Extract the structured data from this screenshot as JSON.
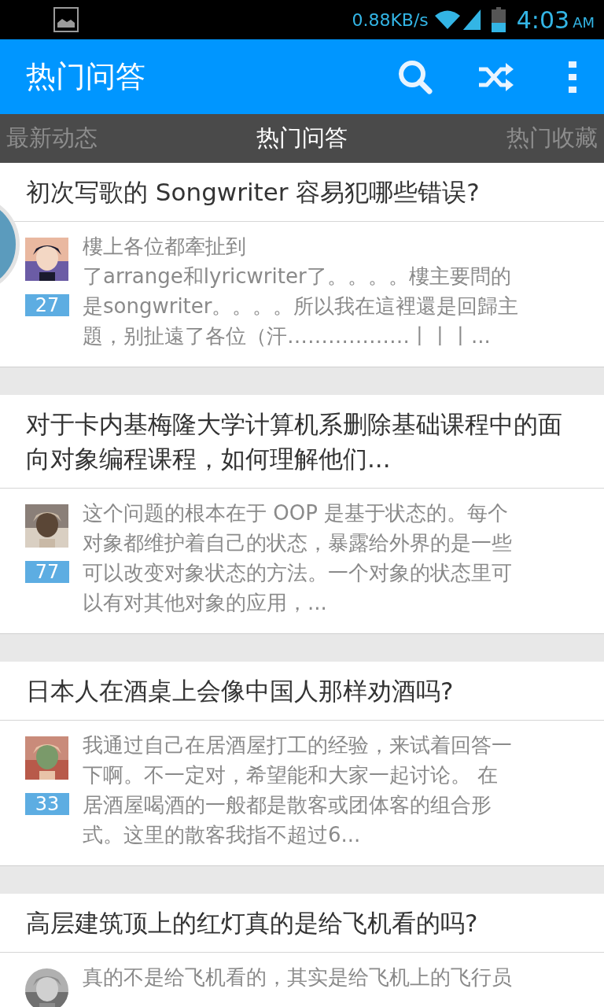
{
  "status_bar": {
    "speed": "0.88KB/s",
    "time": "4:03",
    "ampm": "AM"
  },
  "app_bar": {
    "title": "热门问答"
  },
  "tabs": [
    {
      "label": "最新动态",
      "selected": false
    },
    {
      "label": "热门问答",
      "selected": true
    },
    {
      "label": "热门收藏",
      "selected": false
    }
  ],
  "questions": [
    {
      "title": "初次写歌的 Songwriter 容易犯哪些错误?",
      "answer_lines": [
        "樓上各位都牽扯到",
        "了arrange和lyricwriter了。。。。樓主要問的",
        "是songwriter。。。。所以我在這裡還是回歸主",
        "題，别扯遠了各位（汗………………丨丨丨..."
      ],
      "votes": "27"
    },
    {
      "title": "对于卡内基梅隆大学计算机系删除基础课程中的面向对象编程课程，如何理解他们...",
      "answer_lines": [
        "这个问题的根本在于 OOP 是基于状态的。每个",
        "对象都维护着自己的状态，暴露给外界的是一些",
        "可以改变对象状态的方法。一个对象的状态里可",
        "以有对其他对象的应用，..."
      ],
      "votes": "77"
    },
    {
      "title": "日本人在酒桌上会像中国人那样劝酒吗?",
      "answer_lines": [
        "我通过自己在居酒屋打工的经验，来试着回答一",
        "下啊。不一定对，希望能和大家一起讨论。 在",
        "居酒屋喝酒的一般都是散客或团体客的组合形",
        "式。这里的散客我指不超过6..."
      ],
      "votes": "33"
    },
    {
      "title": "高层建筑顶上的红灯真的是给飞机看的吗?",
      "answer_lines": [
        "真的不是给飞机看的，其实是给飞机上的飞行员"
      ]
    }
  ]
}
